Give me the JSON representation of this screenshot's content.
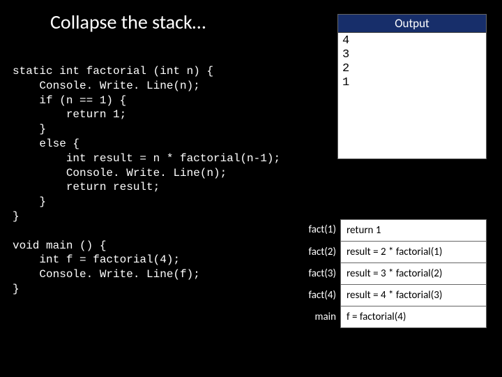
{
  "title": "Collapse the stack…",
  "code": "static int factorial (int n) {\n    Console. Write. Line(n);\n    if (n == 1) {\n        return 1;\n    }\n    else {\n        int result = n * factorial(n-1);\n        Console. Write. Line(n);\n        return result;\n    }\n}\n\nvoid main () {\n    int f = factorial(4);\n    Console. Write. Line(f);\n}",
  "output": {
    "header": "Output",
    "lines": [
      "4",
      "3",
      "2",
      "1"
    ]
  },
  "stack": [
    {
      "label": "fact(1)",
      "value": "return 1"
    },
    {
      "label": "fact(2)",
      "value": "result = 2 * factorial(1)"
    },
    {
      "label": "fact(3)",
      "value": "result = 3 * factorial(2)"
    },
    {
      "label": "fact(4)",
      "value": "result = 4 * factorial(3)"
    },
    {
      "label": "main",
      "value": "f = factorial(4)"
    }
  ]
}
